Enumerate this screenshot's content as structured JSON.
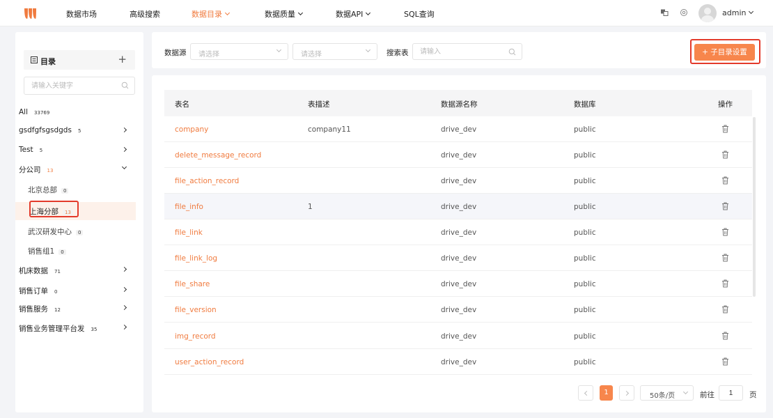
{
  "nav": {
    "items": [
      {
        "label": "数据市场",
        "active": false,
        "dropdown": false
      },
      {
        "label": "高级搜索",
        "active": false,
        "dropdown": false
      },
      {
        "label": "数据目录",
        "active": true,
        "dropdown": true
      },
      {
        "label": "数据质量",
        "active": false,
        "dropdown": true
      },
      {
        "label": "数据API",
        "active": false,
        "dropdown": true
      },
      {
        "label": "SQL查询",
        "active": false,
        "dropdown": false
      }
    ],
    "user": "admin",
    "icons": [
      "translate-icon",
      "settings-icon"
    ]
  },
  "sidebar": {
    "title": "目录",
    "add_icon": "+",
    "search_placeholder": "请输入关键字",
    "items": [
      {
        "label": "All",
        "count": "33769",
        "level": 0,
        "expand": "none"
      },
      {
        "label": "gsdfgfsgsdgds",
        "count": "5",
        "level": 0,
        "expand": "right"
      },
      {
        "label": "Test",
        "count": "5",
        "level": 0,
        "expand": "right"
      },
      {
        "label": "分公司",
        "count": "13",
        "level": 0,
        "expand": "down"
      },
      {
        "label": "北京总部",
        "count": "0",
        "level": 1,
        "expand": "none"
      },
      {
        "label": "上海分部",
        "count": "13",
        "level": 1,
        "expand": "none",
        "selected": true
      },
      {
        "label": "武汉研发中心",
        "count": "0",
        "level": 1,
        "expand": "none"
      },
      {
        "label": "销售组1",
        "count": "0",
        "level": 1,
        "expand": "none"
      },
      {
        "label": "机床数据",
        "count": "71",
        "level": 0,
        "expand": "right"
      },
      {
        "label": "销售订单",
        "count": "0",
        "level": 0,
        "expand": "right"
      },
      {
        "label": "销售服务",
        "count": "12",
        "level": 0,
        "expand": "right"
      },
      {
        "label": "销售业务管理平台发",
        "count": "35",
        "level": 0,
        "expand": "right"
      }
    ]
  },
  "filter": {
    "datasource_label": "数据源",
    "select1_placeholder": "请选择",
    "select2_placeholder": "请选择",
    "search_label": "搜索表",
    "search_placeholder": "请输入",
    "sub_button": "+ 子目录设置"
  },
  "table": {
    "headers": [
      "表名",
      "表描述",
      "数据源名称",
      "数据库",
      "操作"
    ],
    "rows": [
      {
        "name": "company",
        "desc": "company11",
        "source": "drive_dev",
        "db": "public"
      },
      {
        "name": "delete_message_record",
        "desc": "",
        "source": "drive_dev",
        "db": "public"
      },
      {
        "name": "file_action_record",
        "desc": "",
        "source": "drive_dev",
        "db": "public"
      },
      {
        "name": "file_info",
        "desc": "1",
        "source": "drive_dev",
        "db": "public"
      },
      {
        "name": "file_link",
        "desc": "",
        "source": "drive_dev",
        "db": "public"
      },
      {
        "name": "file_link_log",
        "desc": "",
        "source": "drive_dev",
        "db": "public"
      },
      {
        "name": "file_share",
        "desc": "",
        "source": "drive_dev",
        "db": "public"
      },
      {
        "name": "file_version",
        "desc": "",
        "source": "drive_dev",
        "db": "public"
      },
      {
        "name": "img_record",
        "desc": "",
        "source": "drive_dev",
        "db": "public"
      },
      {
        "name": "user_action_record",
        "desc": "",
        "source": "drive_dev",
        "db": "public"
      }
    ],
    "hover_row": 3
  },
  "pagination": {
    "current": "1",
    "page_size": "50条/页",
    "goto_label": "前往",
    "goto_value": "1",
    "page_suffix": "页"
  },
  "colors": {
    "accent": "#f07b3f",
    "button": "#f7864c",
    "highlight_border": "#e33a2b"
  }
}
